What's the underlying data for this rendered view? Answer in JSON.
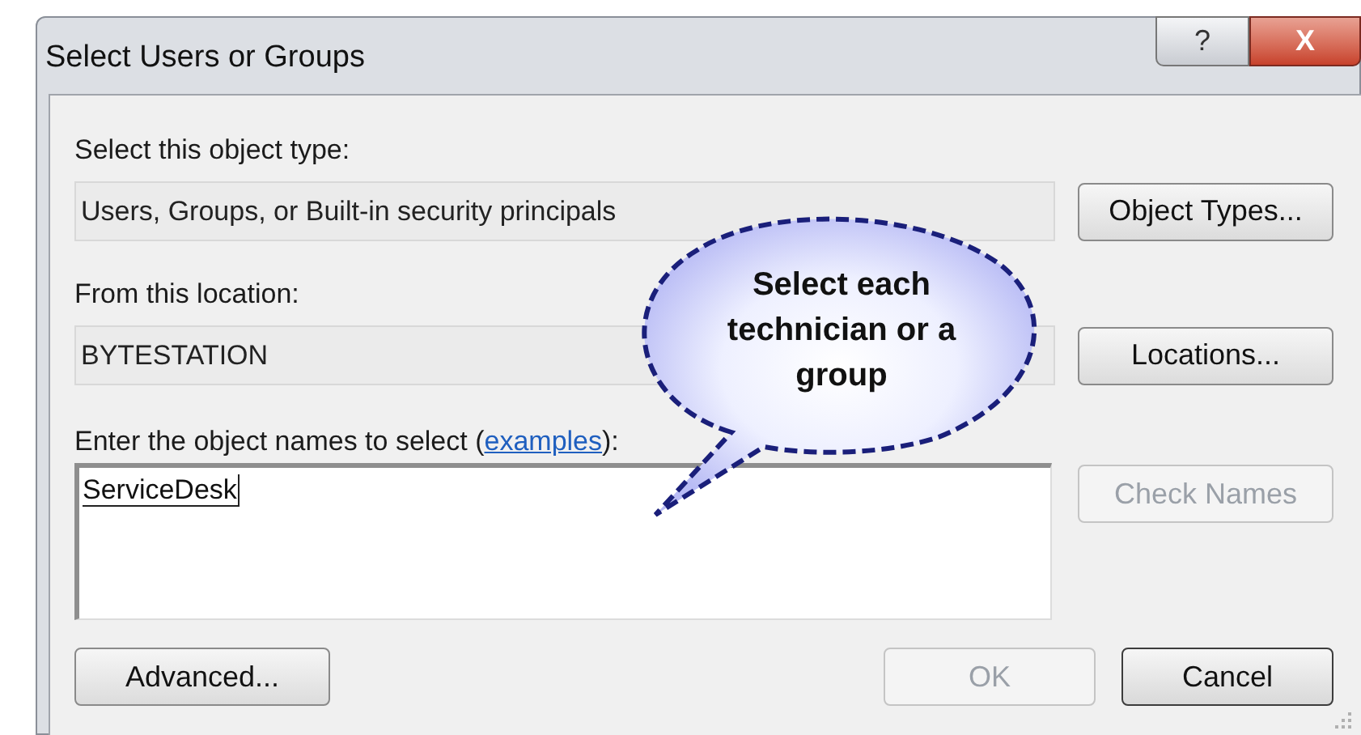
{
  "window": {
    "title": "Select Users or Groups",
    "controls": [
      {
        "kind": "help",
        "label": "?"
      },
      {
        "kind": "close",
        "label": "X"
      }
    ]
  },
  "object_type": {
    "label": "Select this object type:",
    "value": "Users, Groups, or Built-in security principals",
    "button": {
      "label": "Object Types...",
      "disabled": false
    }
  },
  "location": {
    "label": "From this location:",
    "value": "BYTESTATION",
    "button": {
      "label": "Locations...",
      "disabled": false
    }
  },
  "names": {
    "label_before": "Enter the object names to select (",
    "link": "examples",
    "label_after": "):",
    "value": "ServiceDesk",
    "button": {
      "label": "Check Names",
      "disabled": true
    }
  },
  "callout": {
    "text": "Select each technician or a group"
  },
  "buttons": [
    {
      "label": "Advanced...",
      "disabled": false,
      "default": false
    },
    {
      "label": "OK",
      "disabled": true,
      "default": false
    },
    {
      "label": "Cancel",
      "disabled": false,
      "default": true
    }
  ]
}
